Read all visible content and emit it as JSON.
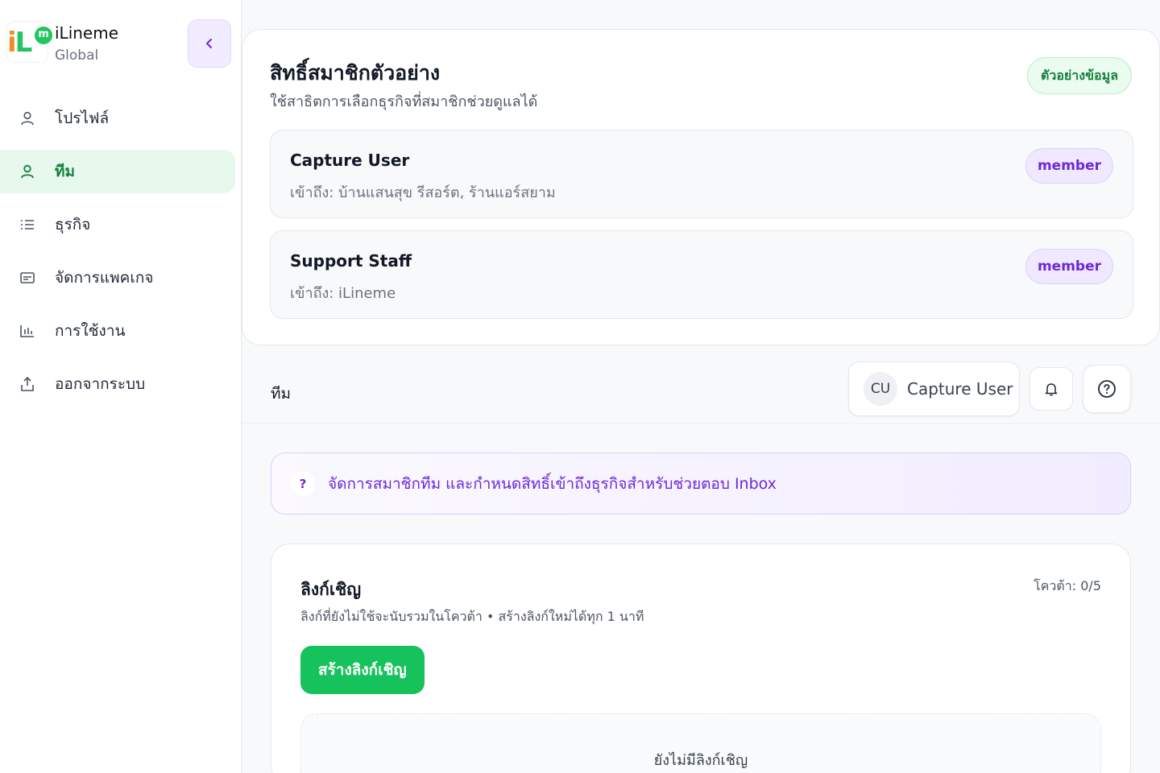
{
  "brand": {
    "name": "iLineme",
    "subtitle": "Global",
    "logo_text": "iL",
    "logo_badge": "m"
  },
  "sidebar": {
    "collapse_icon": "chevron-left-icon",
    "items": [
      {
        "label": "โปรไฟล์",
        "icon": "user-icon",
        "active": false
      },
      {
        "label": "ทีม",
        "icon": "user-icon",
        "active": true
      },
      {
        "label": "ธุรกิจ",
        "icon": "list-icon",
        "active": false
      },
      {
        "label": "จัดการแพคเกจ",
        "icon": "package-icon",
        "active": false
      },
      {
        "label": "การใช้งาน",
        "icon": "bar-chart-icon",
        "active": false
      },
      {
        "label": "ออกจากระบบ",
        "icon": "logout-icon",
        "active": false
      }
    ]
  },
  "permissions": {
    "title": "สิทธิ์สมาชิกตัวอย่าง",
    "subtitle": "ใช้สาธิตการเลือกธุรกิจที่สมาชิกช่วยดูแลได้",
    "badge": "ตัวอย่างข้อมูล",
    "members": [
      {
        "name": "Capture User",
        "access": "เข้าถึง: บ้านแสนสุข รีสอร์ต, ร้านแอร์สยาม",
        "role": "member"
      },
      {
        "name": "Support Staff",
        "access": "เข้าถึง: iLineme",
        "role": "member"
      }
    ]
  },
  "topbar": {
    "page_title": "ทีม",
    "user": {
      "initials": "CU",
      "name": "Capture User"
    },
    "notification_icon": "bell-icon",
    "help_icon": "help-circle-icon"
  },
  "info_banner": {
    "icon": "?",
    "text": "จัดการสมาชิกทีม และกำหนดสิทธิ์เข้าถึงธุรกิจสำหรับช่วยตอบ Inbox"
  },
  "invite": {
    "title": "ลิงก์เชิญ",
    "subtitle": "ลิงก์ที่ยังไม่ใช้จะนับรวมในโควต้า • สร้างลิงก์ใหม่ได้ทุก 1 นาที",
    "quota": "โควต้า: 0/5",
    "create_button": "สร้างลิงก์เชิญ",
    "empty_text": "ยังไม่มีลิงก์เชิญ"
  },
  "colors": {
    "accent_green": "#16c25c",
    "accent_purple": "#6d28d9",
    "active_bg": "#e7f8ec"
  }
}
